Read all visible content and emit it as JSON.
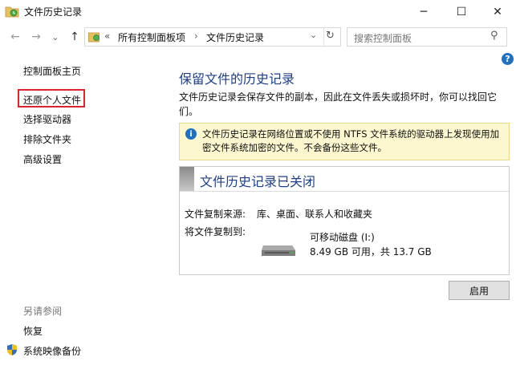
{
  "window": {
    "title": "文件历史记录",
    "minimize_glyph": "─",
    "maximize_glyph": "☐",
    "close_glyph": "✕"
  },
  "nav": {
    "back_glyph": "←",
    "forward_glyph": "→",
    "dropdown_glyph": "⌄",
    "up_glyph": "↑",
    "breadcrumb_overflow": "«",
    "crumbs": [
      "所有控制面板项",
      "文件历史记录"
    ],
    "crumb_separator": "›",
    "address_dropdown_glyph": "⌄",
    "refresh_glyph": "↻",
    "search_placeholder": "搜索控制面板",
    "search_icon_glyph": "⚲",
    "help_glyph": "?"
  },
  "sidebar": {
    "items": [
      {
        "label": "控制面板主页"
      },
      {
        "label": "还原个人文件"
      },
      {
        "label": "选择驱动器"
      },
      {
        "label": "排除文件夹"
      },
      {
        "label": "高级设置"
      }
    ],
    "see_also_heading": "另请参阅",
    "see_also": [
      {
        "label": "恢复"
      },
      {
        "label": "系统映像备份"
      }
    ]
  },
  "main": {
    "title": "保留文件的历史记录",
    "description": "文件历史记录会保存文件的副本，因此在文件丢失或损坏时，你可以找回它们。",
    "info_icon_glyph": "i",
    "info_text": "文件历史记录在网络位置或不使用 NTFS 文件系统的驱动器上发现使用加密文件系统加密的文件。不会备份这些文件。",
    "status": {
      "title": "文件历史记录已关闭",
      "source_label": "文件复制来源:",
      "source_value": "库、桌面、联系人和收藏夹",
      "target_label": "将文件复制到:",
      "drive_name": "可移动磁盘 (I:)",
      "drive_space": "8.49 GB 可用，共 13.7 GB"
    },
    "enable_button": "启用"
  },
  "colors": {
    "accent": "#1e3f87",
    "highlight_border": "#d9252b",
    "info_background": "#fdf7cf",
    "help_blue": "#1f6fc5"
  }
}
